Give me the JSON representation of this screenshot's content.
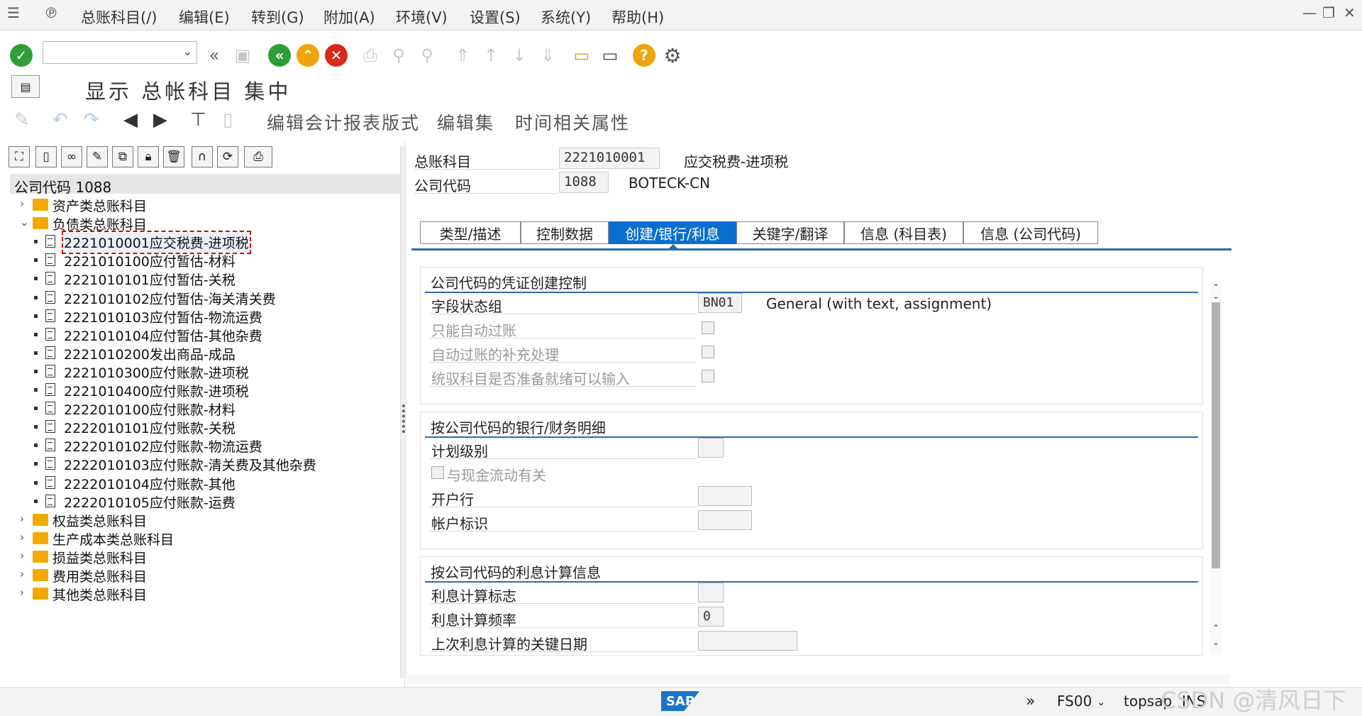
{
  "menu": {
    "items": [
      "总账科目(/)",
      "编辑(E)",
      "转到(G)",
      "附加(A)",
      "环境(V)",
      "设置(S)",
      "系统(Y)",
      "帮助(H)"
    ]
  },
  "window": {
    "minimize": "—",
    "restore": "❐",
    "close": "✕"
  },
  "title": "显示 总帐科目 集中",
  "apptoolbar": {
    "edit_report_layout": "编辑会计报表版式",
    "edit_set": "编辑集",
    "time_attributes": "时间相关属性"
  },
  "tree": {
    "header": "公司代码 1088",
    "nodes": [
      {
        "label": "资产类总账科目",
        "expanded": false
      },
      {
        "label": "负债类总账科目",
        "expanded": true
      },
      {
        "label": "2221010001应交税费-进项税",
        "leaf": true,
        "selected": true
      },
      {
        "label": "2221010100应付暂估-材料",
        "leaf": true
      },
      {
        "label": "2221010101应付暂估-关税",
        "leaf": true
      },
      {
        "label": "2221010102应付暂估-海关清关费",
        "leaf": true
      },
      {
        "label": "2221010103应付暂估-物流运费",
        "leaf": true
      },
      {
        "label": "2221010104应付暂估-其他杂费",
        "leaf": true
      },
      {
        "label": "2221010200发出商品-成品",
        "leaf": true
      },
      {
        "label": "2221010300应付账款-进项税",
        "leaf": true
      },
      {
        "label": "2221010400应付账款-进项税",
        "leaf": true
      },
      {
        "label": "2222010100应付账款-材料",
        "leaf": true
      },
      {
        "label": "2222010101应付账款-关税",
        "leaf": true
      },
      {
        "label": "2222010102应付账款-物流运费",
        "leaf": true
      },
      {
        "label": "2222010103应付账款-清关费及其他杂费",
        "leaf": true
      },
      {
        "label": "2222010104应付账款-其他",
        "leaf": true
      },
      {
        "label": "2222010105应付账款-运费",
        "leaf": true
      },
      {
        "label": "权益类总账科目",
        "expanded": false
      },
      {
        "label": "生产成本类总账科目",
        "expanded": false
      },
      {
        "label": "损益类总账科目",
        "expanded": false
      },
      {
        "label": "费用类总账科目",
        "expanded": false
      },
      {
        "label": "其他类总账科目",
        "expanded": false
      }
    ]
  },
  "header": {
    "gl_account_label": "总账科目",
    "gl_account_value": "2221010001",
    "gl_account_desc": "应交税费-进项税",
    "company_code_label": "公司代码",
    "company_code_value": "1088",
    "company_code_desc": "BOTECK-CN"
  },
  "tabs": [
    {
      "label": "类型/描述",
      "active": false
    },
    {
      "label": "控制数据",
      "active": false
    },
    {
      "label": "创建/银行/利息",
      "active": true
    },
    {
      "label": "关键字/翻译",
      "active": false
    },
    {
      "label": "信息 (科目表)",
      "active": false
    },
    {
      "label": "信息 (公司代码)",
      "active": false
    }
  ],
  "groups": {
    "doc_control": {
      "title": "公司代码的凭证创建控制",
      "field_status_group_label": "字段状态组",
      "field_status_group_value": "BN01",
      "field_status_group_desc": "General (with text, assignment)",
      "auto_post_only_label": "只能自动过账",
      "supplement_auto_post_label": "自动过账的补充处理",
      "recon_ready_label": "统驭科目是否准备就绪可以输入"
    },
    "bank": {
      "title": "按公司代码的银行/财务明细",
      "planning_level_label": "计划级别",
      "cash_flow_label": "与现金流动有关",
      "house_bank_label": "开户行",
      "account_id_label": "帐户标识"
    },
    "interest": {
      "title": "按公司代码的利息计算信息",
      "indicator_label": "利息计算标志",
      "frequency_label": "利息计算频率",
      "frequency_value": "0",
      "last_key_date_label": "上次利息计算的关键日期"
    }
  },
  "status": {
    "transaction": "FS00",
    "user": "topsap",
    "mode": "INS",
    "logo": "SAP",
    "watermark": "CSDN @清风日下"
  },
  "colors": {
    "accent": "#0a6ed1",
    "folder": "#f2a900",
    "ok_green": "#2e9d3a",
    "cancel_red": "#d9281c",
    "exit_orange": "#f0a30a"
  }
}
